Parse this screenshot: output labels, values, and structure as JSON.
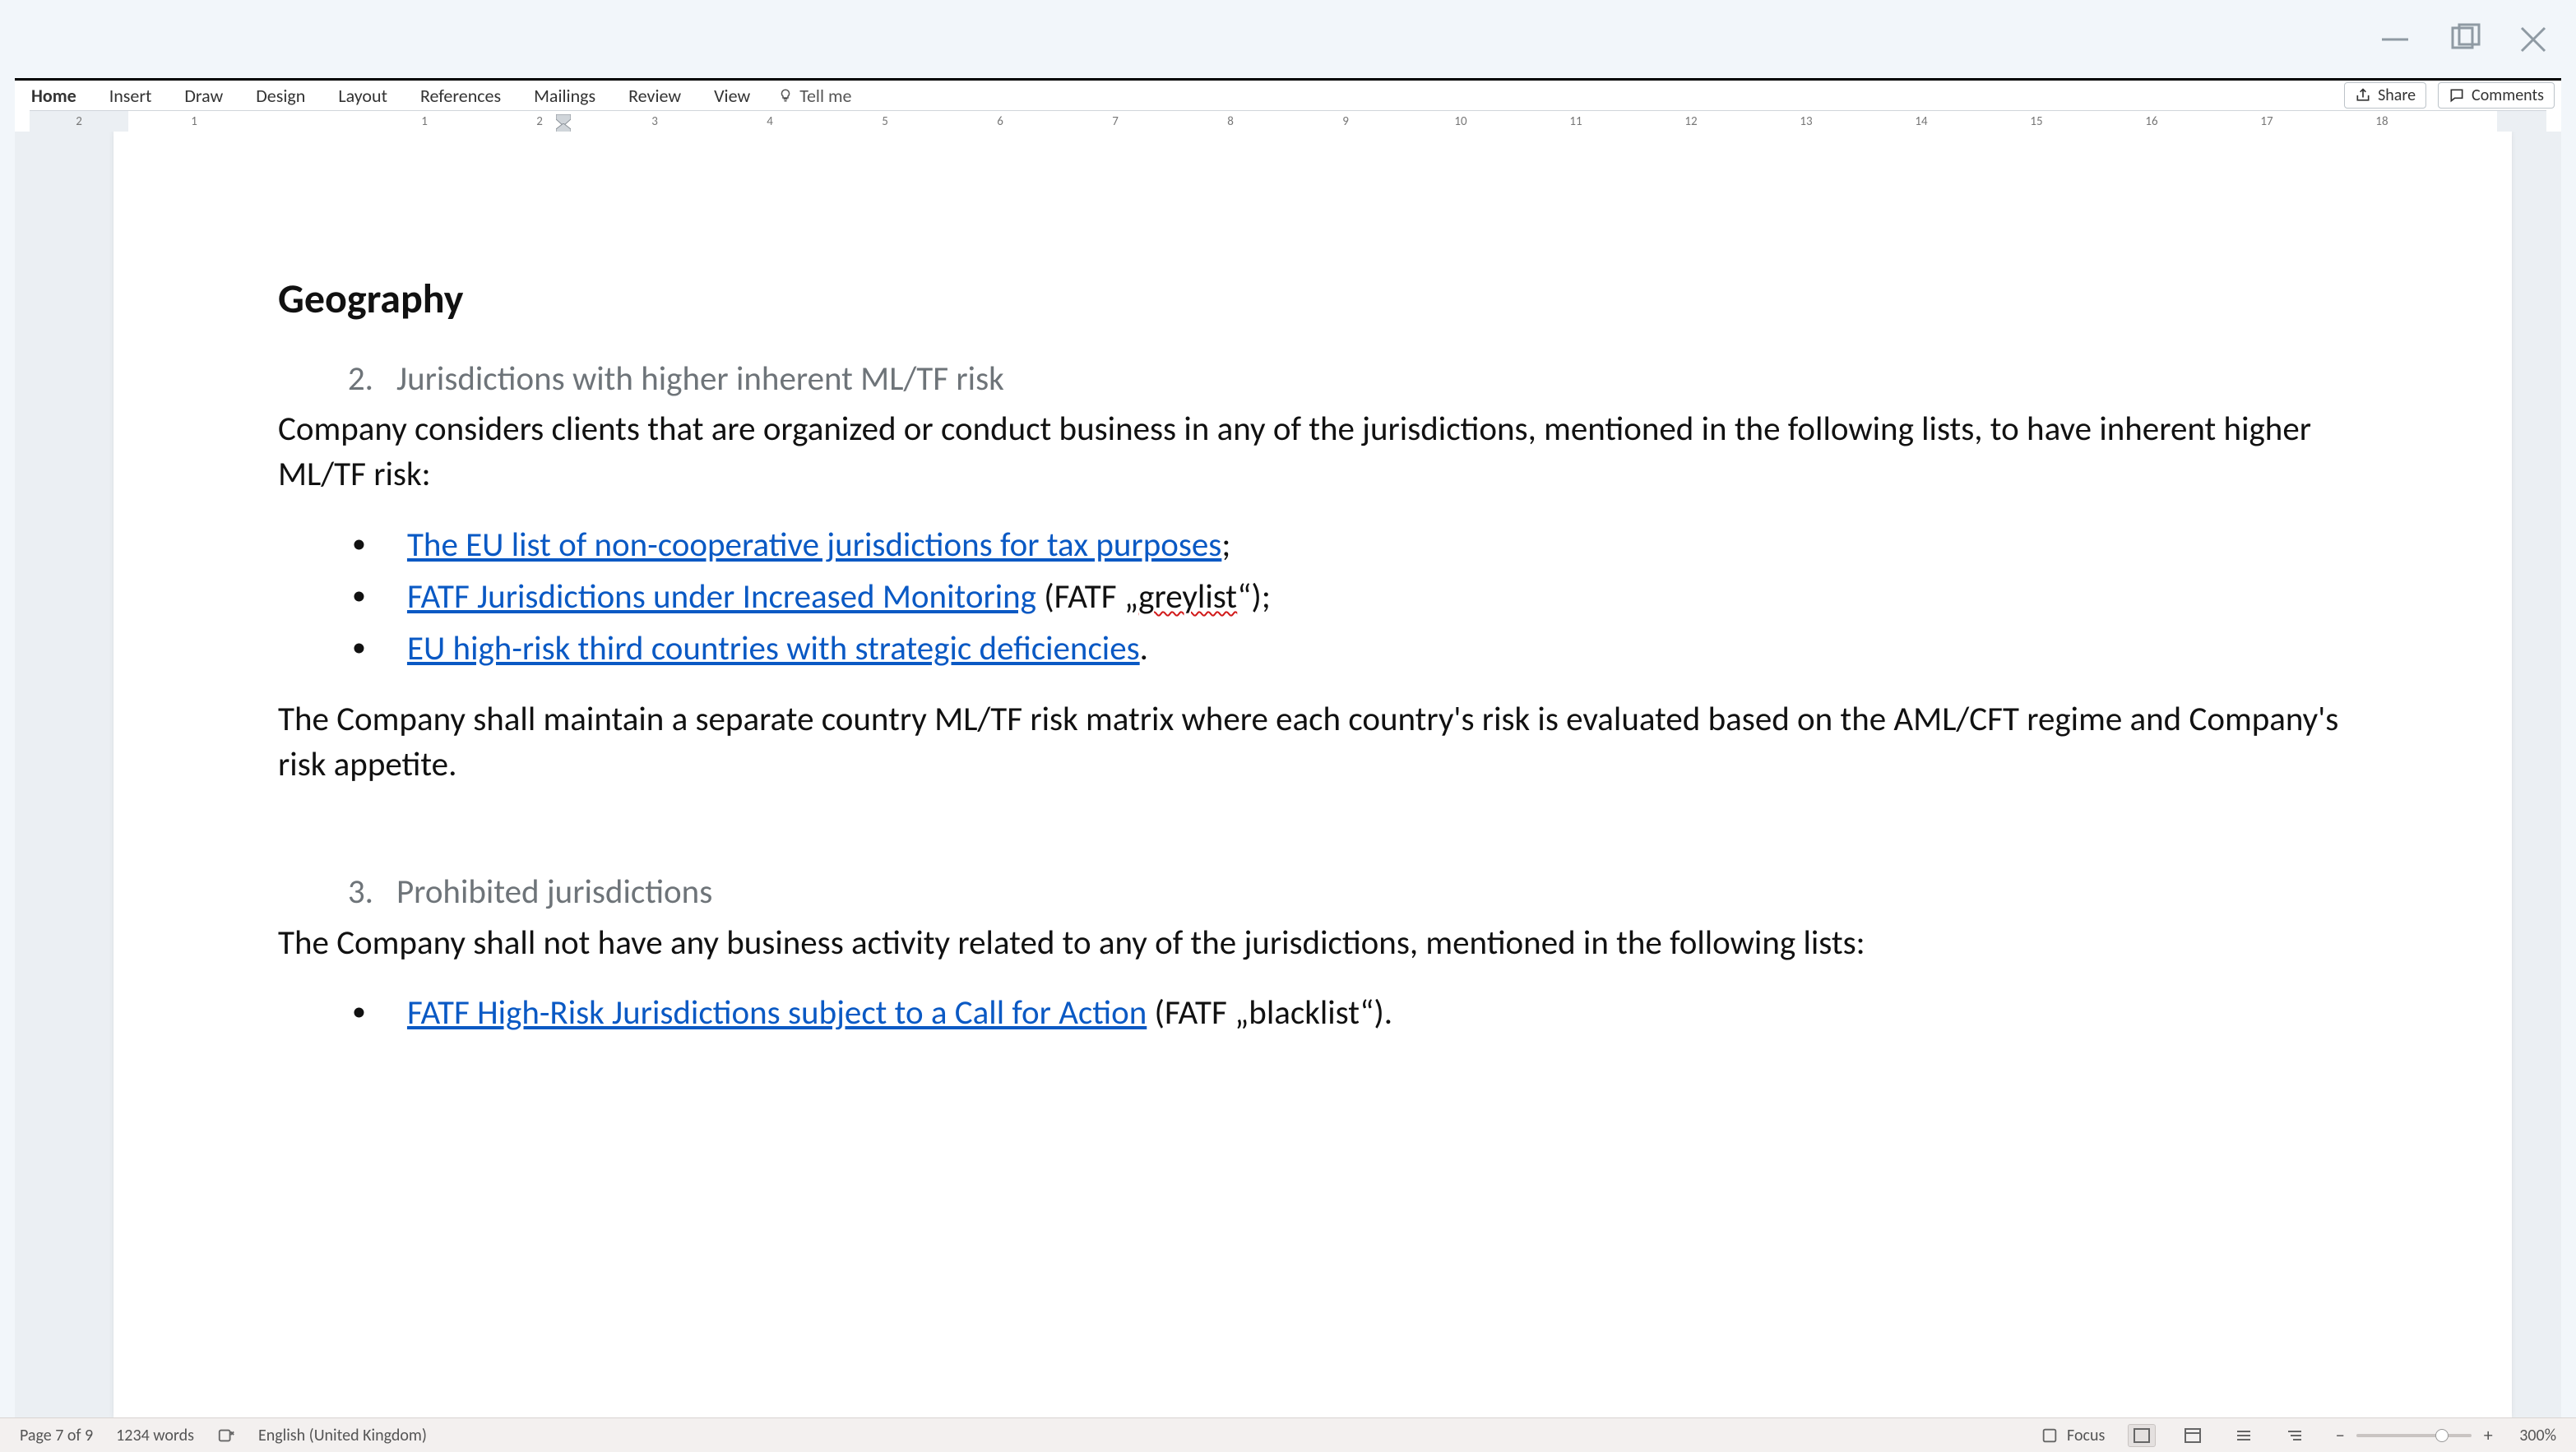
{
  "window": {
    "minimize": "minimize",
    "maximize": "maximize",
    "close": "close"
  },
  "ribbon": {
    "tabs": [
      "Home",
      "Insert",
      "Draw",
      "Design",
      "Layout",
      "References",
      "Mailings",
      "Review",
      "View"
    ],
    "active_tab": "Home",
    "tell_me": "Tell me",
    "share": "Share",
    "comments": "Comments"
  },
  "ruler": {
    "labels": [
      "2",
      "1",
      "1",
      "2",
      "3",
      "4",
      "5",
      "6",
      "7",
      "8",
      "9",
      "10",
      "11",
      "12",
      "13",
      "14",
      "15",
      "16",
      "17",
      "18"
    ]
  },
  "document": {
    "heading": "Geography",
    "section2": {
      "num": "2.",
      "title": "Jurisdictions with higher inherent ML/TF risk",
      "para": "Company considers clients that are organized or conduct business in any of the jurisdictions, mentioned in the following lists, to have inherent higher ML/TF risk:",
      "bullets": [
        {
          "link": "The EU list of non-cooperative jurisdictions for tax purposes",
          "tail": ";"
        },
        {
          "link": "FATF Jurisdictions under Increased Monitoring",
          "tail_pre": " (FATF „",
          "spell": "greylist",
          "tail_post": "“);"
        },
        {
          "link": "EU high-risk third countries with strategic deficiencies",
          "tail": "."
        }
      ],
      "para2": "The Company shall maintain a separate country ML/TF risk matrix where each country's risk is evaluated based on the AML/CFT regime and Company's risk appetite."
    },
    "section3": {
      "num": "3.",
      "title": "Prohibited jurisdictions",
      "para": "The Company shall not have any business activity related to any of the jurisdictions, mentioned in the following lists:",
      "bullets": [
        {
          "link": "FATF High-Risk Jurisdictions subject to a Call for Action",
          "tail": " (FATF „blacklist“)."
        }
      ]
    }
  },
  "status": {
    "page": "Page 7 of 9",
    "words": "1234 words",
    "lang": "English (United Kingdom)",
    "focus": "Focus",
    "zoom": "300%"
  }
}
